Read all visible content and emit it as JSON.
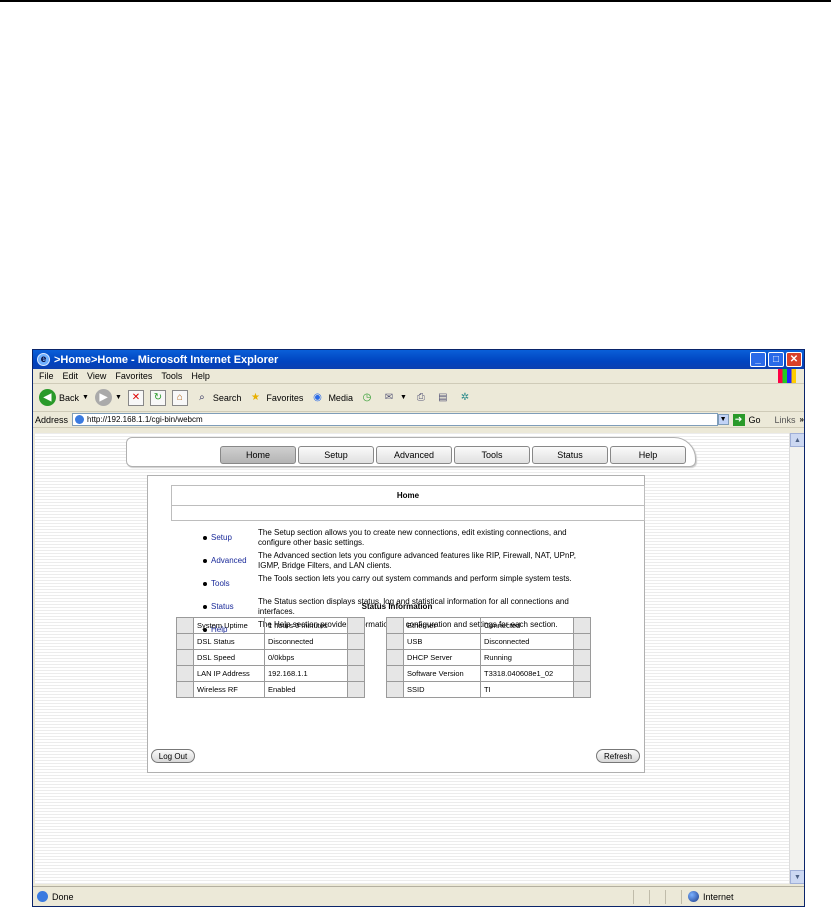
{
  "window": {
    "title": ">Home>Home - Microsoft Internet Explorer"
  },
  "menu": [
    "File",
    "Edit",
    "View",
    "Favorites",
    "Tools",
    "Help"
  ],
  "toolbar": {
    "back": "Back",
    "search": "Search",
    "favorites": "Favorites",
    "media": "Media"
  },
  "address": {
    "label": "Address",
    "url": "http://192.168.1.1/cgi-bin/webcm",
    "go": "Go",
    "links": "Links"
  },
  "nav_tabs": [
    "Home",
    "Setup",
    "Advanced",
    "Tools",
    "Status",
    "Help"
  ],
  "page": {
    "header": "Home",
    "sections": [
      {
        "link": "Setup",
        "desc": "The Setup section allows you to create new connections, edit existing connections, and configure other basic settings."
      },
      {
        "link": "Advanced",
        "desc": "The Advanced section lets you configure advanced features like RIP, Firewall, NAT, UPnP, IGMP, Bridge Filters, and LAN clients."
      },
      {
        "link": "Tools",
        "desc": "The Tools section lets you carry out system commands and perform simple system tests."
      },
      {
        "link": "Status",
        "desc": "The Status section displays status, log and statistical information for all connections and interfaces."
      },
      {
        "link": "Help",
        "desc": "The Help section provides information on configuration and settings for each section."
      }
    ],
    "status_title": "Status Information",
    "status_left": [
      {
        "label": "System Uptime",
        "value": "1 hours 0 minutes"
      },
      {
        "label": "DSL Status",
        "value": "Disconnected"
      },
      {
        "label": "DSL Speed",
        "value": "0/0kbps"
      },
      {
        "label": "LAN IP Address",
        "value": "192.168.1.1"
      },
      {
        "label": "Wireless RF",
        "value": "Enabled"
      }
    ],
    "status_right": [
      {
        "label": "Ethernet",
        "value": "Connected"
      },
      {
        "label": "USB",
        "value": "Disconnected"
      },
      {
        "label": "DHCP Server",
        "value": "Running"
      },
      {
        "label": "Software Version",
        "value": "T3318.040608e1_02"
      },
      {
        "label": "SSID",
        "value": "TI"
      }
    ],
    "log_out": "Log Out",
    "refresh": "Refresh"
  },
  "statusbar": {
    "text": "Done",
    "zone": "Internet"
  }
}
